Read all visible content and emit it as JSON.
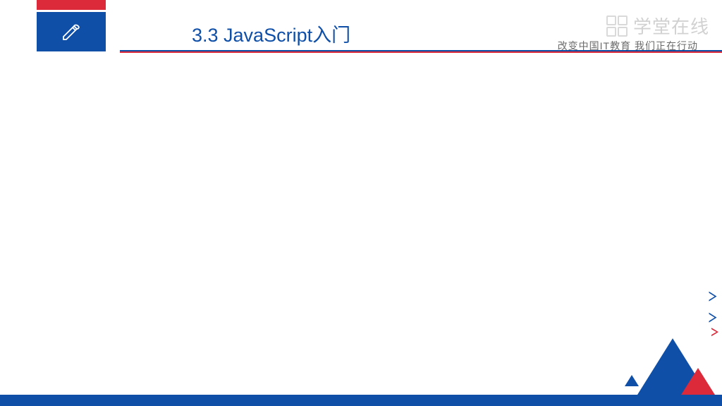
{
  "header": {
    "title": "3.3 JavaScript入门",
    "tagline": "改变中国IT教育 我们正在行动"
  },
  "watermark": {
    "text": "学堂在线"
  },
  "colors": {
    "blue": "#0f4fa8",
    "red": "#dc2a3a"
  }
}
